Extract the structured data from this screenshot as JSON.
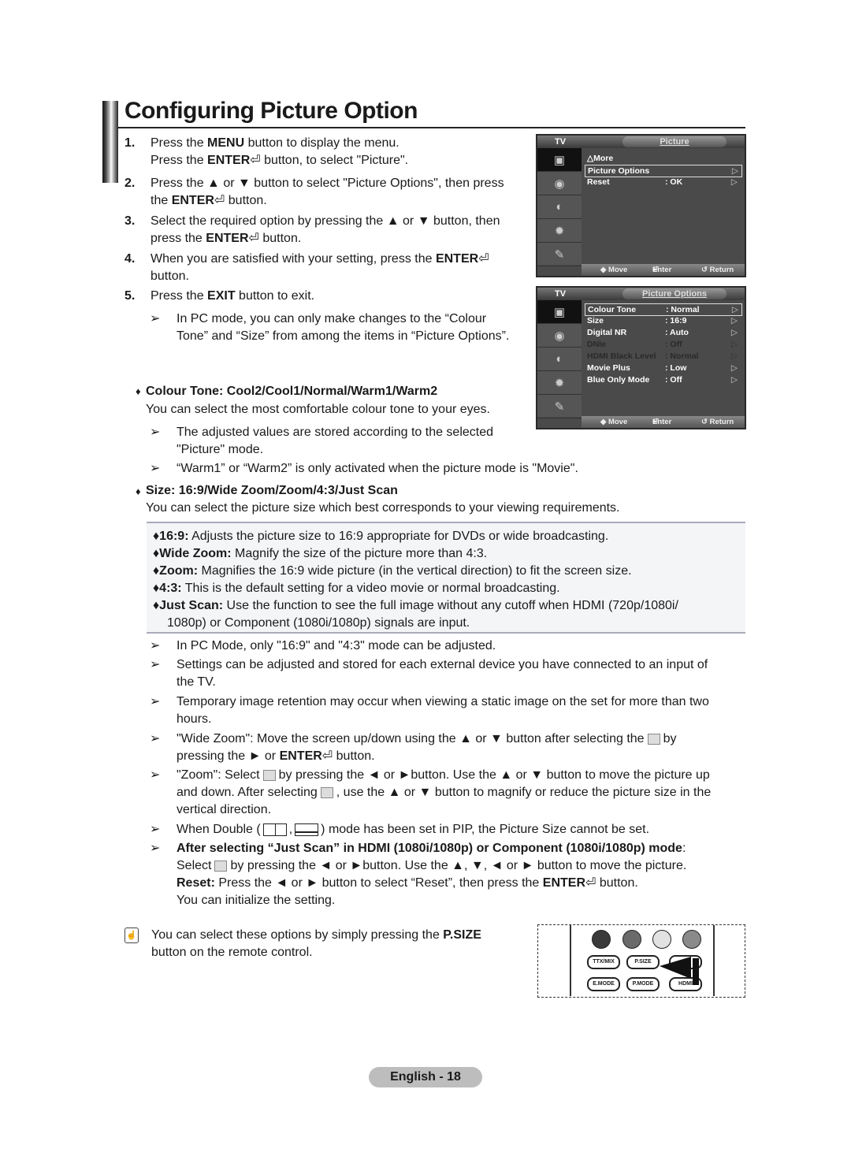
{
  "page": {
    "title": "Configuring Picture Option",
    "footer": "English - 18"
  },
  "steps": [
    {
      "num": "1.",
      "lines": [
        [
          "Press the ",
          {
            "b": "MENU"
          },
          " button to display the menu."
        ],
        [
          "Press the ",
          {
            "b": "ENTER"
          },
          {
            "icon": "enter"
          },
          " button, to select \"Picture\"."
        ]
      ]
    },
    {
      "num": "2.",
      "text_a": "Press the ▲ or ▼ button to select \"Picture Options\", then press",
      "text_b_pre": "the ",
      "text_b_bold": "ENTER",
      "text_b_post": " button."
    },
    {
      "num": "3.",
      "text_a": "Select the required option by pressing the ▲ or ▼ button, then",
      "text_b_pre": "press the ",
      "text_b_bold": "ENTER",
      "text_b_post": " button."
    },
    {
      "num": "4.",
      "text_a_pre": "When you are satisfied with your setting, press the ",
      "text_a_bold": "ENTER",
      "text_b": "button."
    },
    {
      "num": "5.",
      "text_pre": "Press the ",
      "text_bold": "EXIT",
      "text_post": " button to exit."
    }
  ],
  "step1": {
    "l1_pre": "Press the ",
    "l1_bold": "MENU",
    "l1_post": " button to display the menu.",
    "l2_pre": "Press the ",
    "l2_bold": "ENTER",
    "l2_post": " button, to select \"Picture\"."
  },
  "pc_note": {
    "line1": "In PC mode, you can only make changes to the “Colour",
    "line2": "Tone” and “Size” from among the items in “Picture Options”."
  },
  "colour_tone": {
    "heading": "Colour Tone: Cool2/Cool1/Normal/Warm1/Warm2",
    "desc": "You can select the most comfortable colour tone to your eyes.",
    "note1_line1": "The adjusted values are stored according to the selected",
    "note1_line2": "\"Picture\" mode.",
    "note2": "“Warm1” or “Warm2” is only activated when the picture mode is \"Movie\"."
  },
  "size": {
    "heading": "Size: 16:9/Wide Zoom/Zoom/4:3/Just Scan",
    "desc": "You can select the picture size which best corresponds to your viewing requirements.",
    "options": [
      {
        "label": "16:9:",
        "text": " Adjusts the picture size to 16:9 appropriate for DVDs or wide broadcasting."
      },
      {
        "label": "Wide Zoom:",
        "text": " Magnify the size of the picture more than 4:3."
      },
      {
        "label": "Zoom:",
        "text": " Magnifies the 16:9 wide picture (in the vertical direction) to fit the screen size."
      },
      {
        "label": "4:3:",
        "text": " This is the default setting for a video movie or normal broadcasting."
      },
      {
        "label": "Just Scan:",
        "text": " Use the function to see the full image without any cutoff when HDMI (720p/1080i/",
        "text2": "1080p) or Component (1080i/1080p) signals are input."
      }
    ],
    "notes": {
      "pc": "In PC Mode, only \"16:9\" and \"4:3\" mode can be adjusted.",
      "settings_l1": "Settings can be adjusted and stored for each external device you have connected to an input of",
      "settings_l2": "the TV.",
      "retention_l1": "Temporary image retention may occur when viewing a static image on the set for more than two",
      "retention_l2": "hours.",
      "wide_l1_pre": "\"Wide Zoom\": Move the screen up/down using the ▲ or ▼ button after selecting the",
      "wide_l1_post": "by",
      "wide_l2_pre": "pressing the ► or ",
      "wide_l2_bold": "ENTER",
      "wide_l2_post": " button.",
      "zoom_l1_pre": "\"Zoom\": Select",
      "zoom_l1_post": "by pressing the ◄ or ►button. Use the ▲ or ▼ button to move the picture up",
      "zoom_l2_pre": "and down. After selecting",
      "zoom_l2_post": ", use the ▲ or ▼ button to magnify or reduce the picture size in the",
      "zoom_l3": "vertical direction.",
      "double_pre": "When Double (",
      "double_mid": ",",
      "double_post": ") mode has been set in PIP, the Picture Size cannot be set.",
      "justscan_bold": "After selecting “Just Scan” in HDMI (1080i/1080p) or Component (1080i/1080p) mode",
      "justscan_colon": ":",
      "justscan_l2_pre": "Select",
      "justscan_l2_post": "by pressing the ◄ or ►button. Use the ▲, ▼, ◄ or ► button to move the picture.",
      "reset_bold": "Reset:",
      "reset_text": " Press the ◄ or ► button to select “Reset”, then press the ",
      "reset_enter": "ENTER",
      "reset_post": " button.",
      "reset_l2": "You can initialize the setting."
    }
  },
  "tip": {
    "pre": "You can select these options by simply pressing the ",
    "bold": "P.SIZE",
    "line2": "button on the remote control."
  },
  "osd_picture": {
    "tv_label": "TV",
    "title": "Picture",
    "items": [
      {
        "key": "△More",
        "value": "",
        "arrow": ""
      },
      {
        "key": "Picture Options",
        "value": "",
        "arrow": "▷",
        "selected": true
      },
      {
        "key": "Reset",
        "value": ": OK",
        "arrow": "▷"
      }
    ],
    "footer": {
      "move": "◆ Move",
      "enter": "Enter",
      "return": "↺ Return"
    }
  },
  "osd_options": {
    "tv_label": "TV",
    "title": "Picture Options",
    "items": [
      {
        "key": "Colour Tone",
        "value": ": Normal",
        "arrow": "▷",
        "selected": true
      },
      {
        "key": "Size",
        "value": ": 16:9",
        "arrow": "▷"
      },
      {
        "key": "Digital NR",
        "value": ": Auto",
        "arrow": "▷"
      },
      {
        "key": "DNIe",
        "value": ": Off",
        "arrow": "▷",
        "disabled": true
      },
      {
        "key": "HDMI Black Level",
        "value": ": Normal",
        "arrow": "▷",
        "disabled": true
      },
      {
        "key": "Movie Plus",
        "value": ": Low",
        "arrow": "▷"
      },
      {
        "key": "Blue Only Mode",
        "value": ": Off",
        "arrow": "▷"
      }
    ],
    "footer": {
      "move": "◆ Move",
      "enter": "Enter",
      "return": "↺ Return"
    }
  },
  "remote": {
    "colors": [
      "#3a3a3a",
      "#6a6a6a",
      "#e2e2e2",
      "#8a8a8a"
    ],
    "buttons_row1": [
      "TTX/MIX",
      "P.SIZE",
      ""
    ],
    "buttons_row2": [
      "E.MODE",
      "P.MODE",
      "HDMI"
    ]
  },
  "glyphs": {
    "arrow": "➢",
    "diamond": "♦",
    "enter": "⏎",
    "tip": "☝"
  }
}
